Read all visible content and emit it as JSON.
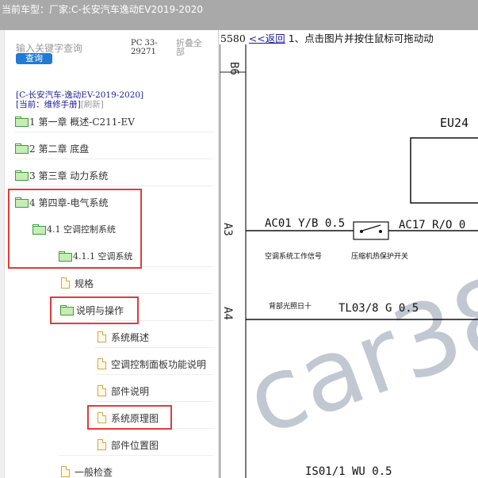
{
  "topbar": {
    "label": "当前车型：",
    "maker": "厂家:C-长安汽车逸动EV2019-2020"
  },
  "sidebar": {
    "search_placeholder": "输入关键字查询",
    "search_button": "查询",
    "pc_code": "PC 33-29271",
    "fold_all": "折叠全部",
    "vehicle": "[C-长安汽车-逸动EV-2019-2020]",
    "current_prefix": "[当前：维修手册]",
    "refresh": "[刷新]",
    "tree": [
      {
        "label": "1 第一章 概述-C211-EV",
        "icon": "folder-icon"
      },
      {
        "label": "2 第二章 底盘",
        "icon": "folder-icon"
      },
      {
        "label": "3 第三章 动力系统",
        "icon": "folder-icon"
      },
      {
        "label": "4 第四章-电气系统",
        "icon": "folder-icon"
      },
      {
        "label": "4.1 空调控制系统",
        "icon": "folder-icon"
      },
      {
        "label": "4.1.1 空调系统",
        "icon": "folder-icon"
      },
      {
        "label": "规格",
        "icon": "file-icon"
      },
      {
        "label": "说明与操作",
        "icon": "folder-icon"
      },
      {
        "label": "系统概述",
        "icon": "file-icon"
      },
      {
        "label": "空调控制面板功能说明",
        "icon": "file-icon"
      },
      {
        "label": "部件说明",
        "icon": "file-icon"
      },
      {
        "label": "系统原理图",
        "icon": "file-icon"
      },
      {
        "label": "部件位置图",
        "icon": "file-icon"
      },
      {
        "label": "一般检查",
        "icon": "file-icon"
      }
    ]
  },
  "content": {
    "page_number": "5580",
    "back_link": "<<返回",
    "instruction": "1、点击图片并按住鼠标可拖动动",
    "diagram": {
      "row_labels": [
        "B6",
        "A3",
        "A4"
      ],
      "component": "EU24",
      "wire_top": "AC01 Y/B 0.5",
      "wire_top_right": "AC17 R/O 0",
      "caption_left": "空调系统工作信号",
      "caption_switch": "压缩机热保护开关",
      "signal_label": "背部光照日十",
      "wire_mid": "TL03/8 G 0.5",
      "wire_bottom": "IS01/1 WU 0.5",
      "watermark": "car38"
    }
  },
  "colors": {
    "topbar_bg": "#a9a9a9",
    "link": "#1a1a99",
    "search_button": "#1f7bd6",
    "highlight": "#e23b3b",
    "folder": "#3c9c3c",
    "file": "#d9a24a"
  }
}
